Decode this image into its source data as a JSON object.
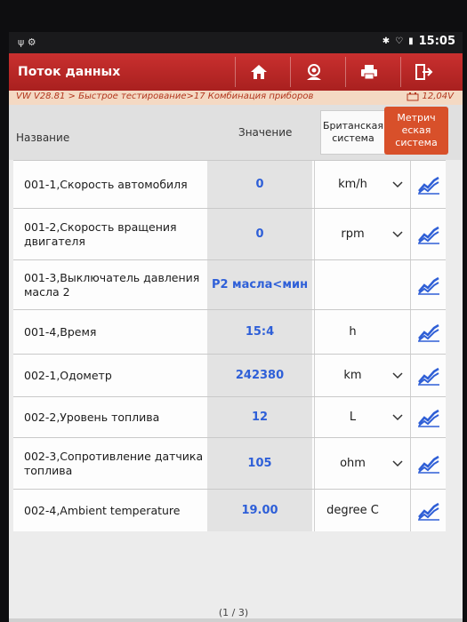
{
  "status_bar": {
    "time": "15:05",
    "icons": [
      "usb-icon",
      "settings-icon",
      "bluetooth-icon",
      "wifi-icon",
      "battery-icon"
    ]
  },
  "header": {
    "title": "Поток данных",
    "buttons": [
      "home-icon",
      "user-icon",
      "print-icon",
      "exit-icon"
    ],
    "color": "#b8282a"
  },
  "breadcrumb": {
    "path": "VW V28.81 > Быстрое тестирование>17 Комбинация приборов",
    "voltage": "12,04V"
  },
  "columns": {
    "name": "Название",
    "value": "Значение",
    "british": "Британская система",
    "metric": "Метрическая система",
    "metric_line1": "Метрич",
    "metric_line2": "еская",
    "metric_line3": "система"
  },
  "rows": [
    {
      "name": "001-1,Скорость автомобиля",
      "value": "0",
      "unit": "km/h",
      "dropdown": true
    },
    {
      "name": "001-2,Скорость вращения двигателя",
      "value": "0",
      "unit": "rpm",
      "dropdown": true
    },
    {
      "name": "001-3,Выключатель давления масла 2",
      "value": "P2 масла<мин",
      "unit": "",
      "dropdown": false
    },
    {
      "name": "001-4,Время",
      "value": "15:4",
      "unit": "h",
      "dropdown": false
    },
    {
      "name": "002-1,Одометр",
      "value": "242380",
      "unit": "km",
      "dropdown": true
    },
    {
      "name": "002-2,Уровень топлива",
      "value": "12",
      "unit": "L",
      "dropdown": true
    },
    {
      "name": "002-3,Сопротивление датчика топлива",
      "value": "105",
      "unit": "ohm",
      "dropdown": true
    },
    {
      "name": "002-4,Ambient temperature",
      "value": "19.00",
      "unit": "degree C",
      "dropdown": false
    }
  ],
  "pager": "(1 / 3)",
  "accent_colors": {
    "value_text": "#2e5fd8",
    "metric_button": "#d8502a",
    "graph_icon": "#2f5fd6"
  }
}
